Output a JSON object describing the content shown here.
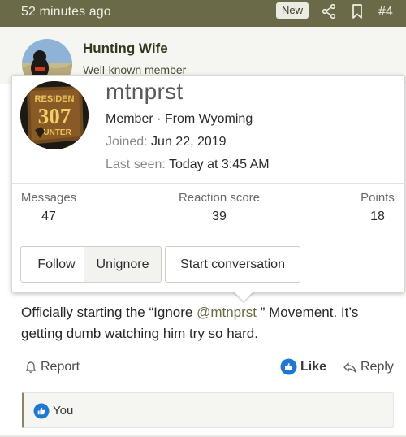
{
  "topbar": {
    "time": "52 minutes ago",
    "badge": "New",
    "share_icon": "share-icon",
    "bookmark_icon": "bookmark-icon",
    "post_number": "#4"
  },
  "author": {
    "name": "Hunting Wife",
    "title": "Well-known member"
  },
  "member_card": {
    "username": "mtnprst",
    "role_line": "Member · From Wyoming",
    "joined_label": "Joined:",
    "joined_value": "Jun 22, 2019",
    "last_seen_label": "Last seen:",
    "last_seen_value": "Today at 3:45 AM",
    "avatar_text_top": "RESIDEN",
    "avatar_text_num": "307",
    "avatar_text_bottom": "HUNTER",
    "stats": [
      {
        "label": "Messages",
        "value": "47"
      },
      {
        "label": "Reaction score",
        "value": "39"
      },
      {
        "label": "Points",
        "value": "18"
      }
    ],
    "buttons": {
      "follow": "Follow",
      "unignore": "Unignore",
      "start_conversation": "Start conversation"
    }
  },
  "message": {
    "before": "Officially starting the “Ignore ",
    "mention": "@mtnprst",
    "after": " ” Movement. It’s getting dumb watching him try so hard."
  },
  "actions": {
    "report": "Report",
    "like": "Like",
    "reply": "Reply"
  },
  "reactions": {
    "text": "You"
  },
  "colors": {
    "topbar_bg": "#6b6a48",
    "like_blue": "#1f78d1",
    "mention": "#6b6a48"
  }
}
